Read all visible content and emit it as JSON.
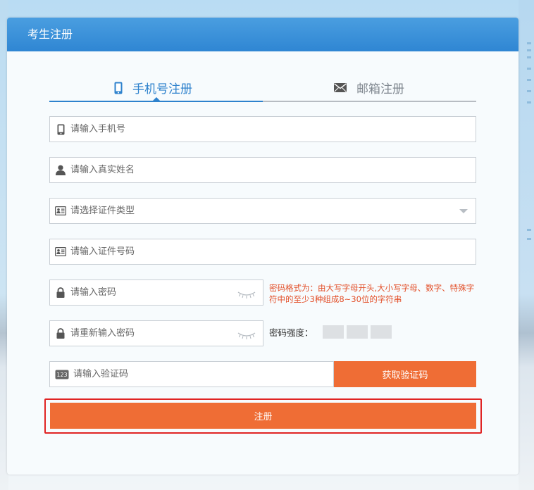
{
  "header": {
    "title": "考生注册"
  },
  "tabs": [
    {
      "label": "手机号注册",
      "icon": "mobile-phone-icon",
      "active": true
    },
    {
      "label": "邮箱注册",
      "icon": "envelope-icon",
      "active": false
    }
  ],
  "form": {
    "phone_placeholder": "请输入手机号",
    "name_placeholder": "请输入真实姓名",
    "id_type_placeholder": "请选择证件类型",
    "id_number_placeholder": "请输入证件号码",
    "password_placeholder": "请输入密码",
    "password_confirm_placeholder": "请重新输入密码",
    "captcha_placeholder": "请输入验证码",
    "captcha_icon_text": "123",
    "password_hint": "密码格式为：由大写字母开头,大小写字母、数字、特殊字符中的至少3种组成8~30位的字符串",
    "strength_label": "密码强度：",
    "get_code_label": "获取验证码",
    "submit_label": "注册"
  },
  "colors": {
    "accent_blue": "#2e82cd",
    "button_orange": "#ef6d35",
    "hint_red": "#e3502a",
    "highlight_red": "#e02424"
  }
}
